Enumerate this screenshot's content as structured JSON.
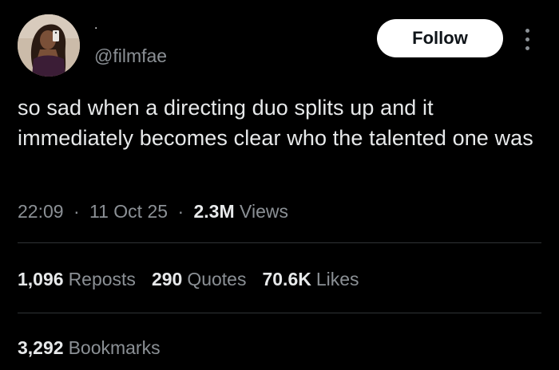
{
  "author": {
    "display_name": ".",
    "handle": "@filmfae",
    "avatar_icon": "profile-photo"
  },
  "follow_label": "Follow",
  "more_icon": "more-vertical-icon",
  "tweet": {
    "text": "so sad when a directing duo splits up and it immediately becomes clear who the talented one was"
  },
  "meta": {
    "time": "22:09",
    "date": "11 Oct 25",
    "views_count": "2.3M",
    "views_label": "Views",
    "separator": "·"
  },
  "stats": {
    "reposts_count": "1,096",
    "reposts_label": "Reposts",
    "quotes_count": "290",
    "quotes_label": "Quotes",
    "likes_count": "70.6K",
    "likes_label": "Likes",
    "bookmarks_count": "3,292",
    "bookmarks_label": "Bookmarks"
  },
  "colors": {
    "background": "#000000",
    "text_primary": "#e7e9ea",
    "text_secondary": "#8b9095",
    "divider": "#2f3336",
    "button_bg": "#ffffff"
  }
}
